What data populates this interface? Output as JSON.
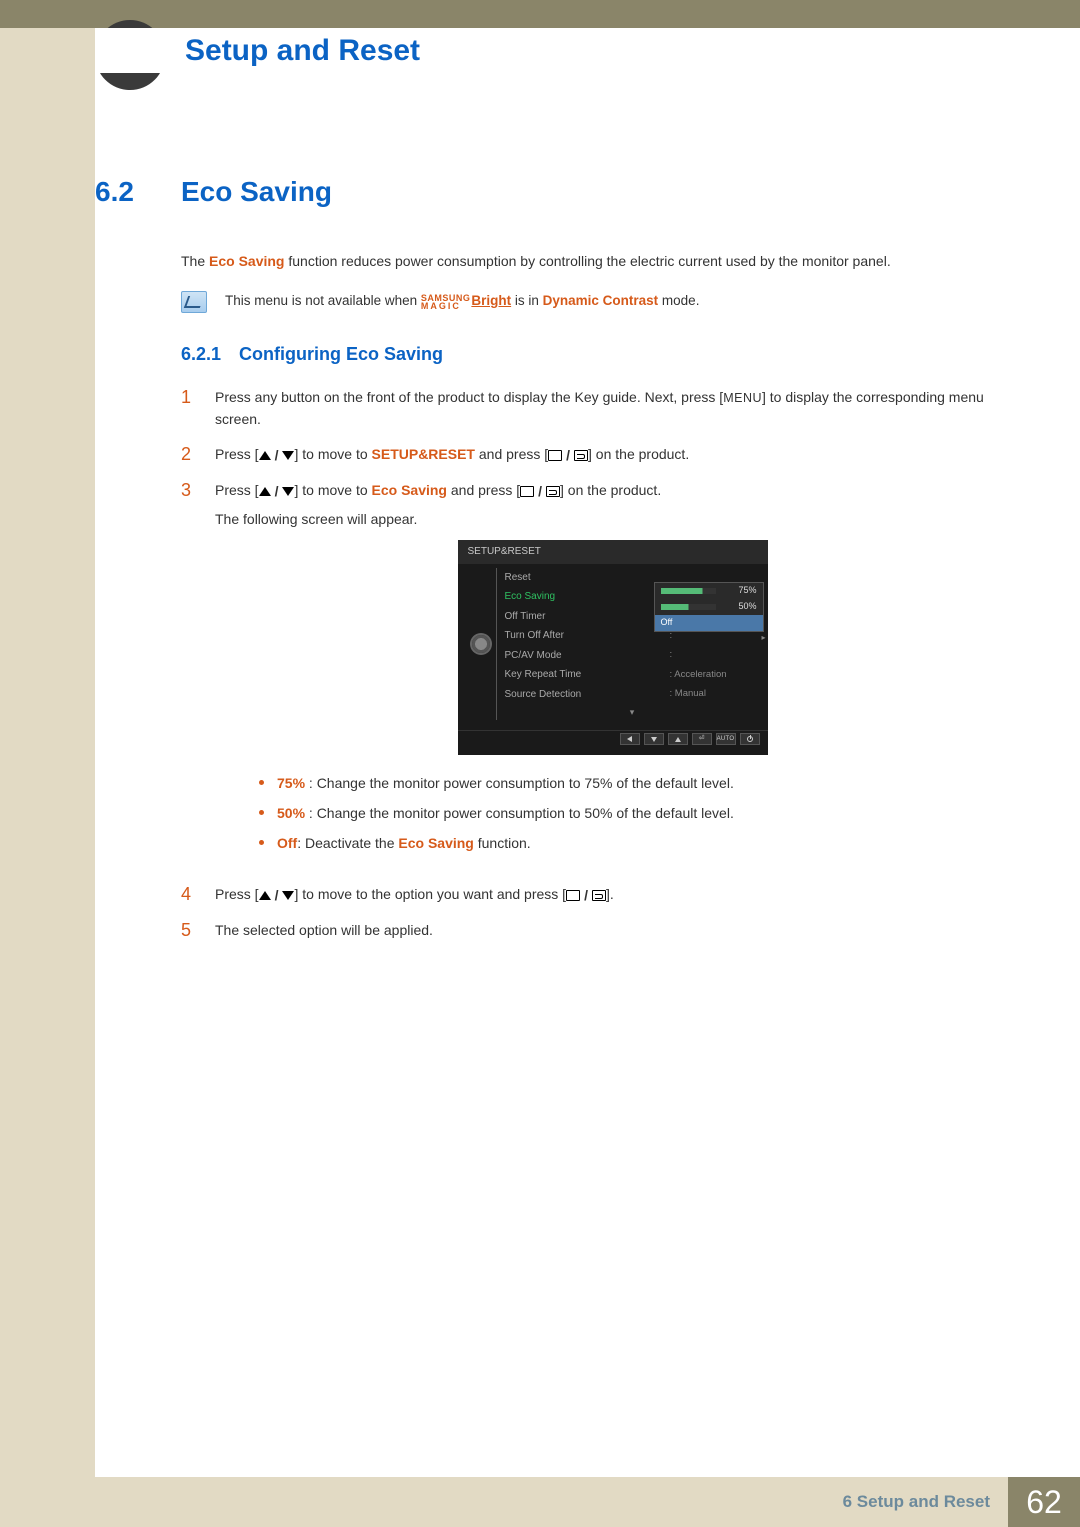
{
  "header": {
    "title": "Setup and Reset"
  },
  "section": {
    "number": "6.2",
    "title": "Eco Saving",
    "intro_pre": "The ",
    "intro_hl": "Eco Saving",
    "intro_post": " function reduces power consumption by controlling the electric current used by the monitor panel."
  },
  "note": {
    "pre": "This menu is not available when ",
    "magic_top": "SAMSUNG",
    "magic_bot": "MAGIC",
    "bright": "Bright",
    "mid": " is in ",
    "dc": "Dynamic Contrast",
    "post": " mode."
  },
  "subsection": {
    "number": "6.2.1",
    "title": "Configuring Eco Saving"
  },
  "steps": {
    "s1_a": "Press any button on the front of the product to display the Key guide. Next, press [",
    "s1_menu": "MENU",
    "s1_b": "] to display the corresponding menu screen.",
    "s2_a": "Press [",
    "s2_b": "] to move to ",
    "s2_target": "SETUP&RESET",
    "s2_c": " and press [",
    "s2_d": "] on the product.",
    "s3_a": "Press [",
    "s3_b": "] to move to ",
    "s3_target": "Eco Saving",
    "s3_c": " and press [",
    "s3_d": "] on the product.",
    "s3_follow": "The following screen will appear.",
    "s4_a": "Press [",
    "s4_b": "] to move to the option you want and press [",
    "s4_c": "].",
    "s5": "The selected option will be applied."
  },
  "bullets": {
    "b1_hl": "75%",
    "b1_txt": " : Change the monitor power consumption to 75% of the default level.",
    "b2_hl": "50%",
    "b2_txt": " : Change the monitor power consumption to 50% of the default level.",
    "b3_hl": "Off",
    "b3_mid": ": Deactivate the ",
    "b3_eco": "Eco Saving",
    "b3_post": " function."
  },
  "osd": {
    "title": "SETUP&RESET",
    "items": [
      {
        "label": "Reset",
        "value": ""
      },
      {
        "label": "Eco Saving",
        "value": ":"
      },
      {
        "label": "Off Timer",
        "value": ":"
      },
      {
        "label": "Turn Off After",
        "value": ":"
      },
      {
        "label": "PC/AV Mode",
        "value": ":"
      },
      {
        "label": "Key Repeat Time",
        "value": ":   Acceleration"
      },
      {
        "label": "Source Detection",
        "value": ":   Manual"
      }
    ],
    "dropdown": {
      "opt1": "75%",
      "opt2": "50%",
      "opt3": "Off"
    },
    "nav_auto": "AUTO"
  },
  "footer": {
    "chapter": "6 Setup and Reset",
    "page": "62"
  }
}
